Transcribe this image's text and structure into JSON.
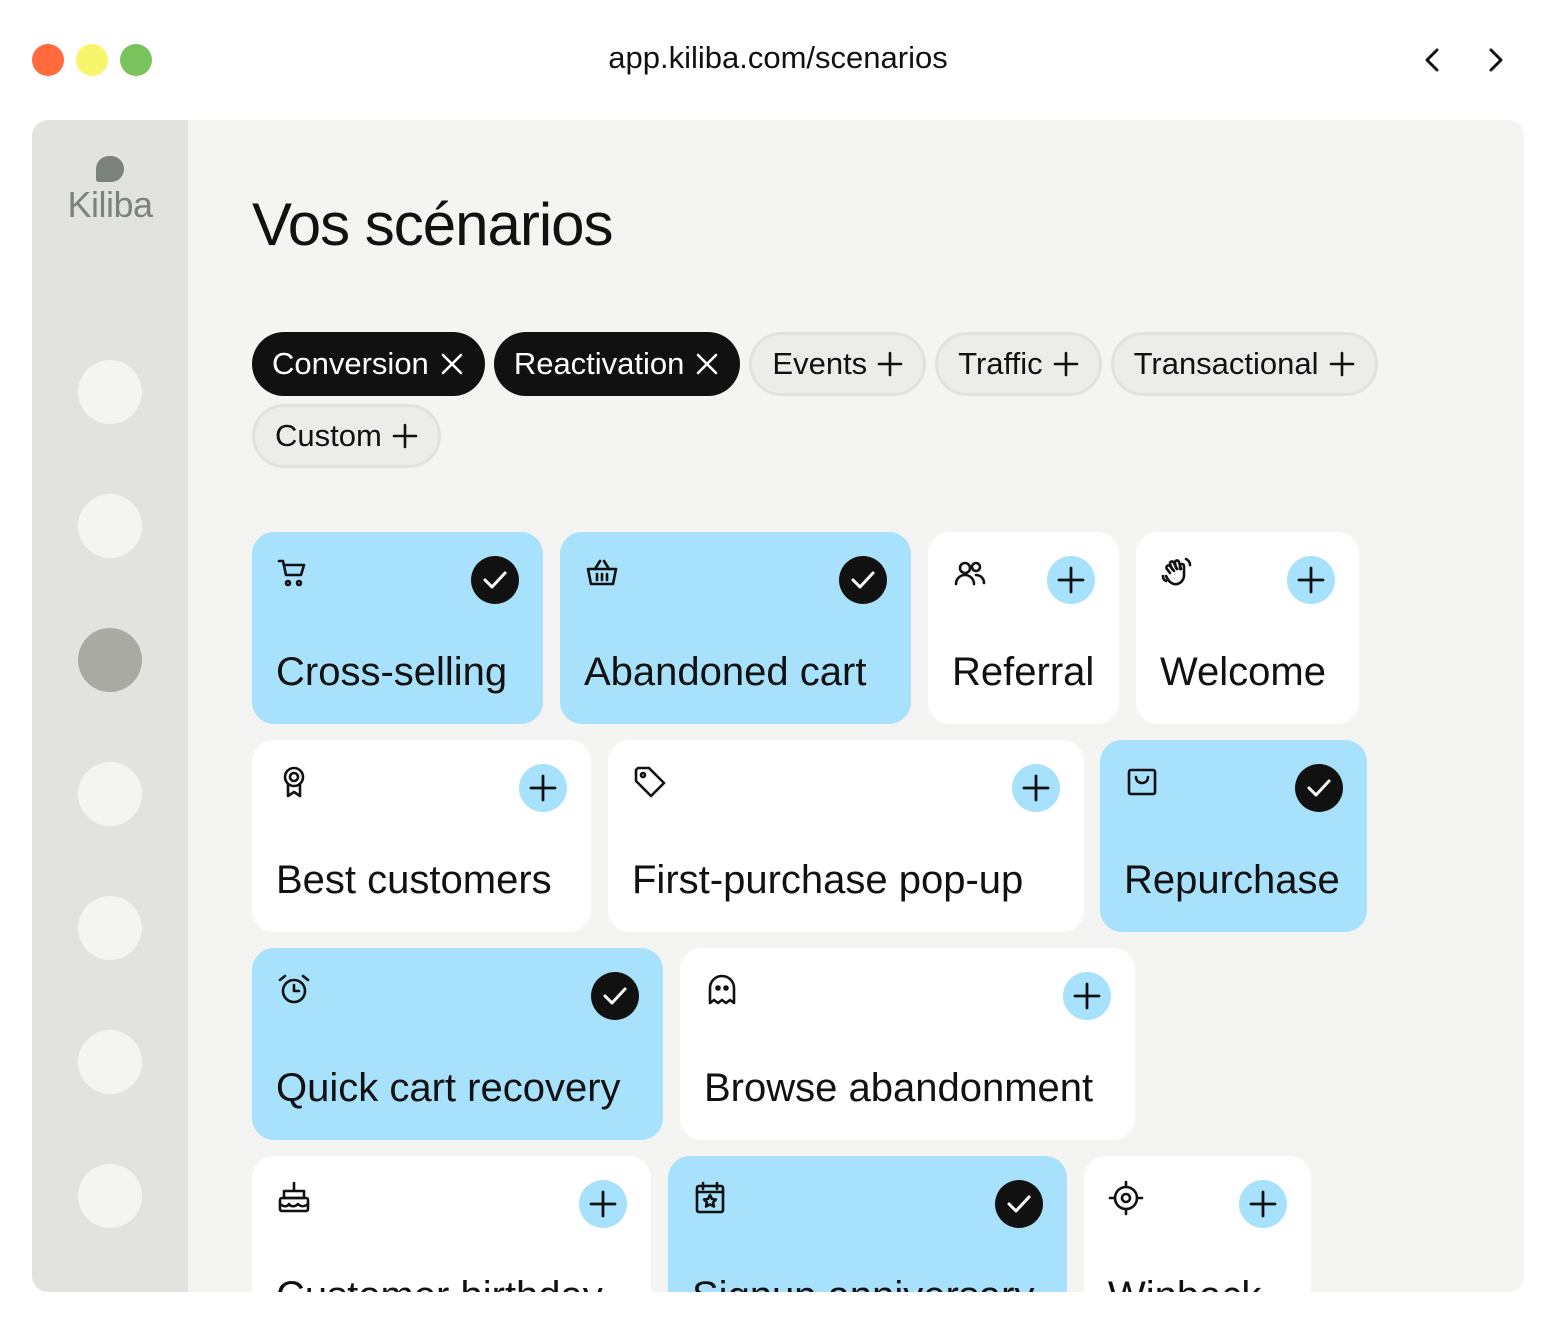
{
  "browser": {
    "url": "app.kiliba.com/scenarios",
    "back_icon": "chevron-left-icon",
    "forward_icon": "chevron-right-icon"
  },
  "sidebar": {
    "logo_text": "Kiliba",
    "active_index": 2
  },
  "page": {
    "title": "Vos scénarios"
  },
  "filters": [
    {
      "label": "Conversion",
      "selected": true
    },
    {
      "label": "Reactivation",
      "selected": true
    },
    {
      "label": "Events",
      "selected": false
    },
    {
      "label": "Traffic",
      "selected": false
    },
    {
      "label": "Transactional",
      "selected": false
    },
    {
      "label": "Custom",
      "selected": false
    }
  ],
  "scenarios": [
    {
      "label": "Cross-selling",
      "icon": "shopping-cart-icon",
      "active": true
    },
    {
      "label": "Abandoned cart",
      "icon": "basket-icon",
      "active": true
    },
    {
      "label": "Referral",
      "icon": "users-icon",
      "active": false
    },
    {
      "label": "Welcome",
      "icon": "waving-hand-icon",
      "active": false
    },
    {
      "label": "Best customers",
      "icon": "award-icon",
      "active": false
    },
    {
      "label": "First-purchase pop-up",
      "icon": "tag-icon",
      "active": false
    },
    {
      "label": "Repurchase",
      "icon": "shopping-bag-icon",
      "active": true
    },
    {
      "label": "Quick cart recovery",
      "icon": "alarm-clock-icon",
      "active": true
    },
    {
      "label": "Browse abandonment",
      "icon": "ghost-icon",
      "active": false
    },
    {
      "label": "Customer birthday",
      "icon": "cake-icon",
      "active": false
    },
    {
      "label": "Signup anniversary",
      "icon": "calendar-star-icon",
      "active": true
    },
    {
      "label": "Winback",
      "icon": "target-icon",
      "active": false
    }
  ],
  "colors": {
    "active_card": "#a8e1fb",
    "selected_chip": "#111111",
    "sidebar": "#e2e2de",
    "content_bg": "#f4f4f2"
  }
}
